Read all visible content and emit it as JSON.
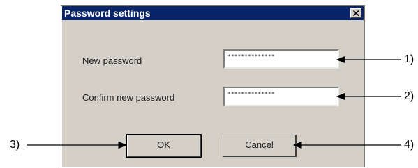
{
  "dialog": {
    "title": "Password settings",
    "close_icon": "close-icon"
  },
  "fields": {
    "new_password_label": "New password",
    "new_password_value": "**************",
    "confirm_password_label": "Confirm new password",
    "confirm_password_value": "**************"
  },
  "buttons": {
    "ok_label": "OK",
    "cancel_label": "Cancel"
  },
  "callouts": {
    "c1": "1)",
    "c2": "2)",
    "c3": "3)",
    "c4": "4)"
  },
  "colors": {
    "titlebar": "#0a246a",
    "dialog_face": "#d4d0c8"
  }
}
